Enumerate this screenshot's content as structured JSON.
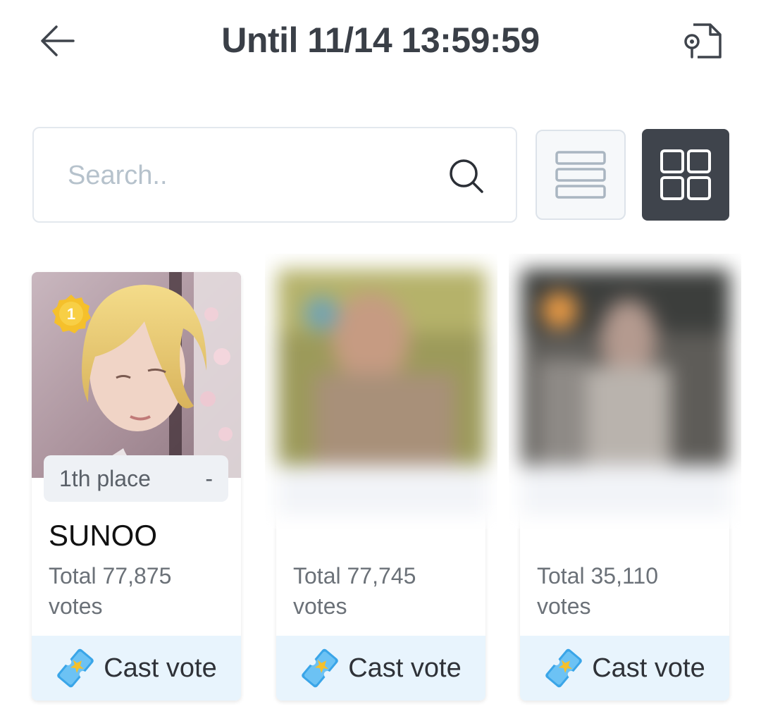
{
  "header": {
    "title": "Until 11/14 13:59:59",
    "back_icon": "arrow-left-icon",
    "share_icon": "document-share-icon"
  },
  "search": {
    "placeholder": "Search..",
    "icon": "search-icon"
  },
  "view_toggle": {
    "list_icon": "list-view-icon",
    "grid_icon": "grid-view-icon",
    "active": "grid"
  },
  "cards": [
    {
      "place_label": "1th place",
      "change": "-",
      "name": "SUNOO",
      "total_votes": "Total 77,875 votes",
      "vote_label": "Cast vote",
      "medal_number": "1"
    },
    {
      "total_votes": "Total 77,745 votes",
      "vote_label": "Cast vote"
    },
    {
      "total_votes": "Total 35,110 votes",
      "vote_label": "Cast vote"
    }
  ],
  "colors": {
    "accent_dark": "#3f444c",
    "vote_bg": "#e8f4fd",
    "badge_bg": "#eef1f5",
    "medal": "#f5c02b"
  }
}
